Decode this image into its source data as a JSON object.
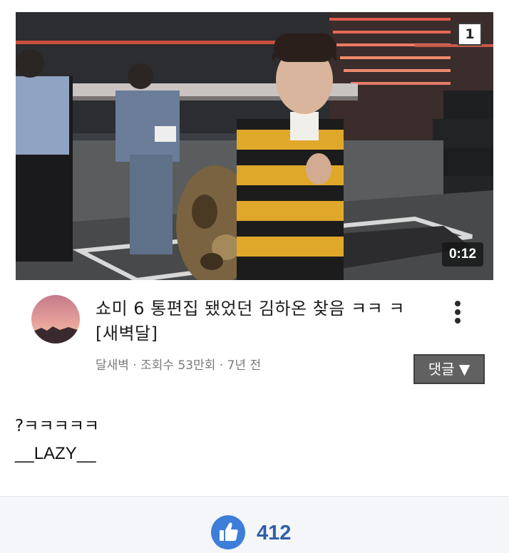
{
  "video": {
    "badge": "1",
    "duration": "0:12",
    "title": "쇼미 6 통편집 됐었던 김하온 찾음 ㅋㅋ ㅋ [새벽달]",
    "meta": "달새벽 · 조회수 53만회 · 7년 전",
    "comment_button_label": "댓글 ▼",
    "thumbnail_icon": "video-thumbnail-image",
    "avatar_icon": "channel-avatar-sunset"
  },
  "comment": {
    "line1": "?ㅋㅋㅋㅋㅋ",
    "line2": "__LAZY__"
  },
  "likes": {
    "count": "412",
    "icon": "thumbs-up-icon"
  },
  "colors": {
    "like_button": "#3d7ed8",
    "like_count": "#2f5fa8",
    "comment_button": "#616161"
  }
}
